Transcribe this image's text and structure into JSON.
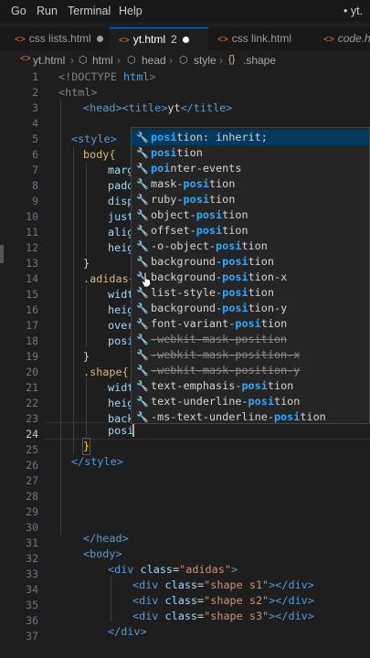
{
  "menubar": {
    "items": [
      "Go",
      "Run",
      "Terminal",
      "Help"
    ],
    "title": "• yt."
  },
  "tabs": [
    {
      "label": "css lists.html",
      "modified": true,
      "active": false
    },
    {
      "label": "yt.html",
      "count": "2",
      "modified": true,
      "active": true
    },
    {
      "label": "css link.html",
      "modified": false,
      "active": false
    },
    {
      "label": "code.ht",
      "modified": false,
      "active": false
    }
  ],
  "breadcrumb": {
    "file": "yt.html",
    "b1": "html",
    "b2": "head",
    "b3": "style",
    "b4": ".shape"
  },
  "line_numbers": [
    "1",
    "2",
    "3",
    "4",
    "5",
    "6",
    "7",
    "8",
    "9",
    "10",
    "11",
    "12",
    "13",
    "14",
    "15",
    "16",
    "17",
    "18",
    "19",
    "20",
    "21",
    "22",
    "23",
    "24",
    "25",
    "26",
    "27",
    "28",
    "29",
    "30",
    "31",
    "32",
    "33",
    "34",
    "35",
    "36",
    "37"
  ],
  "code": {
    "l1a": "<!DOCTYPE ",
    "l1b": "html",
    "l2": "<html>",
    "l3a": "<head>",
    "l3b": "<title>",
    "l3c": "yt",
    "l3d": "</title>",
    "l5": "<style>",
    "l6": "body{",
    "l7": "marg",
    "l8": "padd",
    "l9": "disp",
    "l10": "just",
    "l11": "alig",
    "l12": "heig",
    "l13": "}",
    "l14": ".adidas{",
    "l15": "widt",
    "l16": "heig",
    "l17": "over",
    "l18": "posi",
    "l19": "}",
    "l20": ".shape{",
    "l21": "widt",
    "l22": "heig",
    "l23": "back",
    "l24": "posi",
    "l25": "}",
    "l26": "</style>",
    "l31": "</head>",
    "l32": "<body>",
    "l33a": "<div ",
    "l33b": "class",
    "l33c": "=",
    "l33d": "\"adidas\"",
    "l33e": ">",
    "l34a": "<div ",
    "l34b": "class",
    "l34c": "=",
    "l34d": "\"shape s1\"",
    "l34e": "></div>",
    "l35a": "<div ",
    "l35b": "class",
    "l35c": "=",
    "l35d": "\"shape s2\"",
    "l35e": "></div>",
    "l36a": "<div ",
    "l36b": "class",
    "l36c": "=",
    "l36d": "\"shape s3\"",
    "l36e": "></div>",
    "l37": "</div>"
  },
  "suggestions": [
    {
      "m": "posi",
      "r": "tion: inherit;"
    },
    {
      "m": "posi",
      "r": "tion"
    },
    {
      "p": "",
      "m": "poi",
      "r": "nter-events"
    },
    {
      "p": "mask-",
      "m": "posi",
      "r": "tion"
    },
    {
      "p": "ruby-",
      "m": "posi",
      "r": "tion"
    },
    {
      "p": "object-",
      "m": "posi",
      "r": "tion"
    },
    {
      "p": "offset-",
      "m": "posi",
      "r": "tion"
    },
    {
      "p": "-o-object-",
      "m": "posi",
      "r": "tion"
    },
    {
      "p": "background-",
      "m": "posi",
      "r": "tion"
    },
    {
      "p": "background-",
      "m": "posi",
      "r": "tion-x"
    },
    {
      "p": "list-style-",
      "m": "posi",
      "r": "tion"
    },
    {
      "p": "background-",
      "m": "posi",
      "r": "tion-y"
    },
    {
      "p": "font-variant-",
      "m": "posi",
      "r": "tion"
    },
    {
      "p": "-webkit-mask-position",
      "m": "",
      "r": ""
    },
    {
      "p": "-webkit-mask-position-x",
      "m": "",
      "r": ""
    },
    {
      "p": "-webkit-mask-position-y",
      "m": "",
      "r": ""
    },
    {
      "p": "text-emphasis-",
      "m": "posi",
      "r": "tion"
    },
    {
      "p": "text-underline-",
      "m": "posi",
      "r": "tion"
    },
    {
      "p": "-ms-text-underline-",
      "m": "posi",
      "r": "tion"
    }
  ],
  "colors": {
    "accent": "#2aaaff",
    "selected_row": "#04395e",
    "tag": "#569cd6",
    "attribute": "#9cdcfe",
    "string": "#ce9178",
    "selector": "#d7ba7d"
  }
}
